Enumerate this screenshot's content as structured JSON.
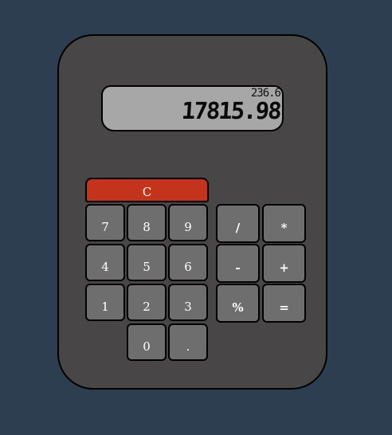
{
  "display": {
    "secondary": "236.6",
    "primary": "17815.98"
  },
  "keys": {
    "clear": "C",
    "seven": "7",
    "eight": "8",
    "nine": "9",
    "four": "4",
    "five": "5",
    "six": "6",
    "one": "1",
    "two": "2",
    "three": "3",
    "zero": "0",
    "decimal": ".",
    "divide": "/",
    "multiply": "*",
    "subtract": "-",
    "add": "+",
    "percent": "%",
    "equals": "="
  },
  "colors": {
    "background": "#2d3e50",
    "calculator_body": "#484646",
    "display_bg": "#a7a7a7",
    "key_bg": "#6e6e6e",
    "clear_key_bg": "#c4341d"
  }
}
